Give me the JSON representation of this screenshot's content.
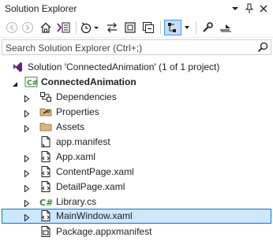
{
  "window": {
    "title": "Solution Explorer"
  },
  "search": {
    "placeholder": "Search Solution Explorer (Ctrl+;)"
  },
  "tree": {
    "solution": "Solution 'ConnectedAnimation' (1 of 1 project)",
    "project": "ConnectedAnimation",
    "items": [
      {
        "label": "Dependencies",
        "icon": "dependencies-icon"
      },
      {
        "label": "Properties",
        "icon": "properties-folder-icon"
      },
      {
        "label": "Assets",
        "icon": "folder-icon"
      },
      {
        "label": "app.manifest",
        "icon": "manifest-file-icon"
      },
      {
        "label": "App.xaml",
        "icon": "xaml-file-icon"
      },
      {
        "label": "ContentPage.xaml",
        "icon": "xaml-file-icon"
      },
      {
        "label": "DetailPage.xaml",
        "icon": "xaml-file-icon"
      },
      {
        "label": "Library.cs",
        "icon": "csharp-file-icon"
      },
      {
        "label": "MainWindow.xaml",
        "icon": "xaml-file-icon",
        "selected": true
      },
      {
        "label": "Package.appxmanifest",
        "icon": "appxmanifest-file-icon"
      }
    ]
  },
  "colors": {
    "selection_bg": "#cce8ff",
    "selection_border": "#0078d4",
    "folder": "#dcb67a",
    "csharp": "#388a34",
    "vs_purple": "#68217a"
  }
}
